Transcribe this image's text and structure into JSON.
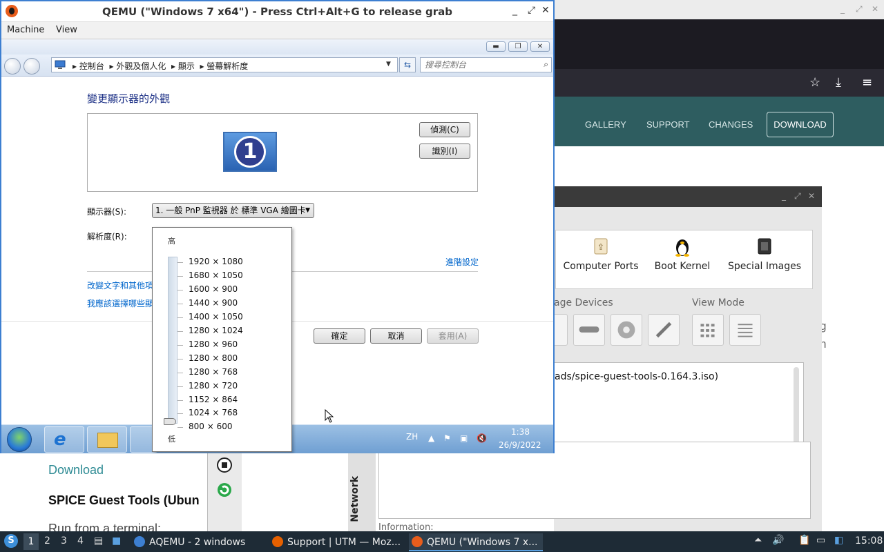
{
  "qemu": {
    "title": "QEMU (\"Windows 7 x64\") - Press Ctrl+Alt+G to release grab",
    "menu": [
      "Machine",
      "View"
    ]
  },
  "explorer": {
    "breadcrumbs": [
      "控制台",
      "外觀及個人化",
      "顯示",
      "螢幕解析度"
    ],
    "search_placeholder": "搜尋控制台"
  },
  "display_settings": {
    "heading": "變更顯示器的外觀",
    "monitor_number": "1",
    "detect_button": "偵測(C)",
    "identify_button": "識別(I)",
    "display_label": "顯示器(S):",
    "display_value": "1. 一般 PnP 監視器 於 標準 VGA 繪圖卡",
    "resolution_label": "解析度(R):",
    "advanced_link": "進階設定",
    "link_text_size": "改變文字和其他項",
    "link_which": "我應該選擇哪些顯",
    "ok_button": "確定",
    "cancel_button": "取消",
    "apply_button": "套用(A)"
  },
  "resolution_popup": {
    "high_label": "高",
    "low_label": "低",
    "options": [
      "1920 × 1080",
      "1680 × 1050",
      "1600 × 900",
      "1440 × 900",
      "1400 × 1050",
      "1280 × 1024",
      "1280 × 960",
      "1280 × 800",
      "1280 × 768",
      "1280 × 720",
      "1152 × 864",
      "1024 × 768",
      "800 × 600"
    ],
    "selected": "800 × 600"
  },
  "guest_taskbar": {
    "lang": "ZH",
    "time": "1:38",
    "date": "26/9/2022"
  },
  "background_browser": {
    "nav": [
      "GALLERY",
      "SUPPORT",
      "CHANGES",
      "DOWNLOAD"
    ],
    "side_text": [
      "g",
      "h"
    ],
    "download_heading": "Download",
    "spice_heading": "SPICE Guest Tools (Ubun",
    "run_text": "Run from a terminal:"
  },
  "aqemu": {
    "items": [
      "Computer Ports",
      "Boot Kernel",
      "Special Images"
    ],
    "storage_group": "age Devices",
    "view_mode_group": "View Mode",
    "iso_path": "ads/spice-guest-tools-0.164.3.iso)",
    "network_tab": "Network",
    "information_label": "Information:"
  },
  "host_taskbar": {
    "workspaces": [
      "1",
      "2",
      "3",
      "4"
    ],
    "tasks": [
      "AQEMU - 2 windows",
      "Support | UTM — Moz...",
      "QEMU (\"Windows 7 x..."
    ],
    "clock": "15:08"
  },
  "colors": {
    "accent_blue": "#3d7fd1",
    "nav_teal": "#2e5d60",
    "link_blue": "#0066cc",
    "heading_blue": "#1e3287"
  }
}
